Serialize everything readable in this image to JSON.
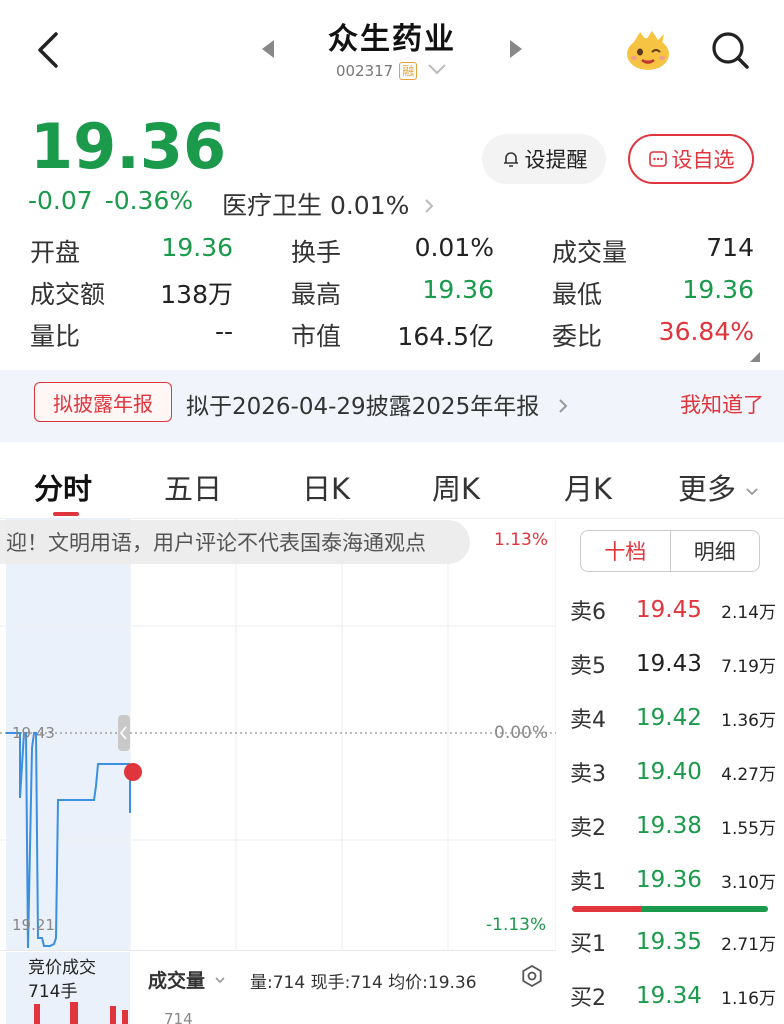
{
  "header": {
    "title": "众生药业",
    "code": "002317",
    "margin_badge": "融"
  },
  "quote": {
    "price": "19.36",
    "change": "-0.07",
    "change_pct": "-0.36%",
    "sector": "医疗卫生 0.01%",
    "remind_label": "设提醒",
    "fav_label": "设自选"
  },
  "stats": [
    [
      {
        "label": "开盘",
        "value": "19.36",
        "color": "green"
      },
      {
        "label": "换手",
        "value": "0.01%",
        "color": "dark"
      },
      {
        "label": "成交量",
        "value": "714",
        "color": "dark"
      }
    ],
    [
      {
        "label": "成交额",
        "value": "138万",
        "color": "dark"
      },
      {
        "label": "最高",
        "value": "19.36",
        "color": "green"
      },
      {
        "label": "最低",
        "value": "19.36",
        "color": "green"
      }
    ],
    [
      {
        "label": "量比",
        "value": "--",
        "color": "dark"
      },
      {
        "label": "市值",
        "value": "164.5亿",
        "color": "dark"
      },
      {
        "label": "委比",
        "value": "36.84%",
        "color": "red"
      }
    ]
  ],
  "notice": {
    "badge": "拟披露年报",
    "text": "拟于2026-04-29披露2025年年报",
    "dismiss": "我知道了"
  },
  "tabs": [
    "分时",
    "五日",
    "日K",
    "周K",
    "月K",
    "更多"
  ],
  "chart": {
    "comment": "迎！文明用语，用户评论不代表国泰海通观点",
    "pct_top": "1.13%",
    "pct_mid": "0.00%",
    "pct_bot": "-1.13%",
    "price_mid": "19.43",
    "price_bot": "19.21"
  },
  "orderbook": {
    "toggle_on": "十档",
    "toggle_off": "明细",
    "rows": [
      {
        "label": "卖6",
        "price": "19.45",
        "vol": "2.14万",
        "color": "red"
      },
      {
        "label": "卖5",
        "price": "19.43",
        "vol": "7.19万",
        "color": "dark"
      },
      {
        "label": "卖4",
        "price": "19.42",
        "vol": "1.36万",
        "color": "green"
      },
      {
        "label": "卖3",
        "price": "19.40",
        "vol": "4.27万",
        "color": "green"
      },
      {
        "label": "卖2",
        "price": "19.38",
        "vol": "1.55万",
        "color": "green"
      },
      {
        "label": "卖1",
        "price": "19.36",
        "vol": "3.10万",
        "color": "green"
      },
      {
        "label": "买1",
        "price": "19.35",
        "vol": "2.71万",
        "color": "green"
      },
      {
        "label": "买2",
        "price": "19.34",
        "vol": "1.16万",
        "color": "green"
      }
    ]
  },
  "volume": {
    "auction_line1": "竞价成交",
    "auction_line2": "714手",
    "dropdown": "成交量",
    "info": "量:714  现手:714  均价:19.36",
    "axis_value": "714"
  },
  "colors": {
    "red": "#e0353d",
    "green": "#1a9a4a",
    "line": "#3b8fe0"
  }
}
